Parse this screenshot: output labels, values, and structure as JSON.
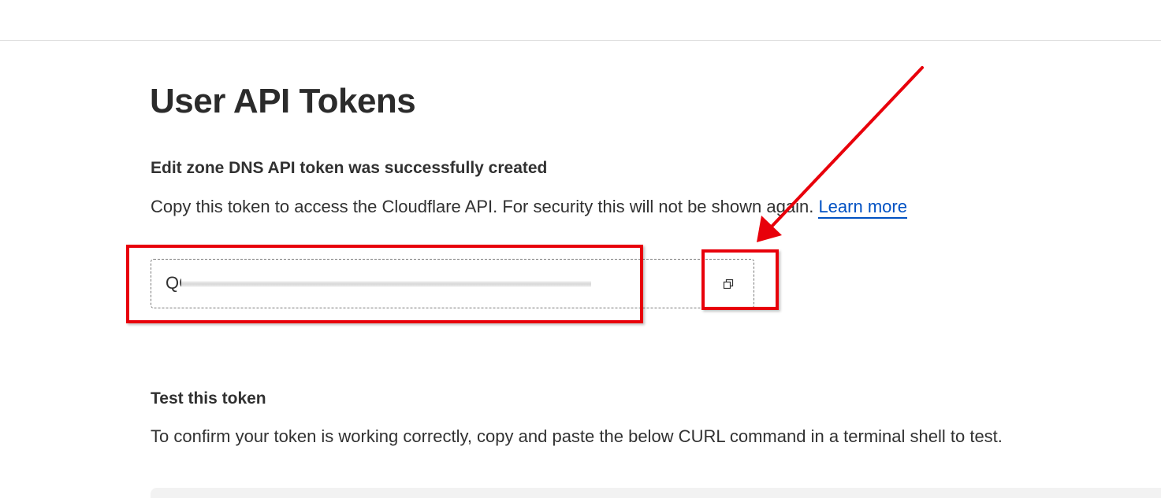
{
  "page": {
    "title": "User API Tokens"
  },
  "token_created": {
    "heading": "Edit zone DNS API token was successfully created",
    "description": "Copy this token to access the Cloudflare API. For security this will not be shown again.",
    "learn_more_label": "Learn more",
    "token_value": "QC                                                  Pm",
    "copy_icon": "copy-icon"
  },
  "test_token": {
    "heading": "Test this token",
    "description": "To confirm your token is working correctly, copy and paste the below CURL command in a terminal shell to test."
  },
  "colors": {
    "annotation_red": "#e8000b",
    "link_blue": "#0051c3",
    "text": "#313131"
  }
}
